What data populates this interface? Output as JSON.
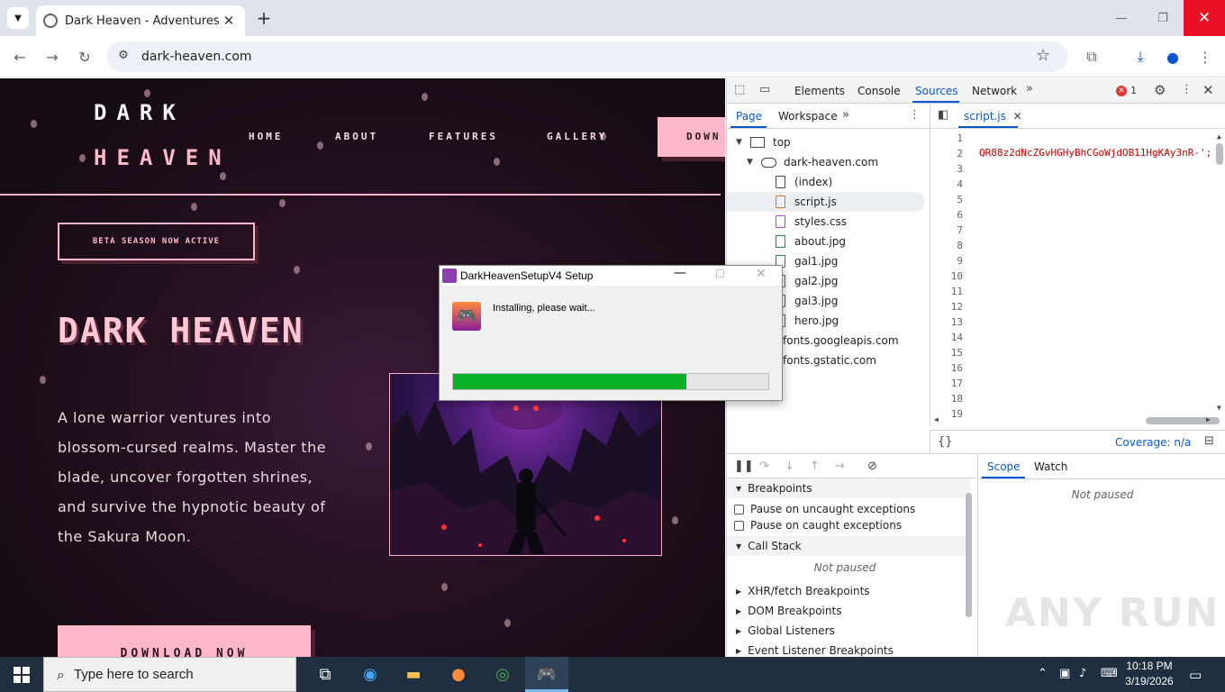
{
  "browser": {
    "tab_title": "Dark Heaven - Adventures of a",
    "url": "dark-heaven.com",
    "new_tab_glyph": "+"
  },
  "page": {
    "logo_line1": "DARK",
    "logo_line2": "HEAVEN",
    "nav": [
      "HOME",
      "ABOUT",
      "FEATURES",
      "GALLERY"
    ],
    "nav_download": "DOWN",
    "badge": "BETA SEASON NOW ACTIVE",
    "hero_title": "DARK HEAVEN",
    "hero_desc": "A lone warrior ventures into blossom-cursed realms. Master the blade, uncover forgotten shrines, and survive the hypnotic beauty of the Sakura Moon.",
    "hero_button": "DOWNLOAD NOW"
  },
  "devtools": {
    "tabs": [
      "Elements",
      "Console",
      "Sources",
      "Network"
    ],
    "error_count": "1",
    "left_tabs": [
      "Page",
      "Workspace"
    ],
    "tree": {
      "top": "top",
      "domain": "dark-heaven.com",
      "files": [
        "(index)",
        "script.js",
        "styles.css",
        "about.jpg",
        "gal1.jpg",
        "gal2.jpg",
        "gal3.jpg",
        "hero.jpg"
      ],
      "other_domains": [
        "fonts.googleapis.com",
        "fonts.gstatic.com"
      ]
    },
    "open_file": "script.js",
    "line_numbers": [
      "1",
      "2",
      "3",
      "4",
      "5",
      "6",
      "7",
      "8",
      "9",
      "10",
      "11",
      "12",
      "13",
      "14",
      "15",
      "16",
      "17",
      "18",
      "19"
    ],
    "code_line_2": "QR88z2dNcZGvHGHyBhCGoWjdOB11HgKAy3nR-';",
    "coverage": "Coverage: n/a",
    "breakpoints_header": "Breakpoints",
    "pause_uncaught": "Pause on uncaught exceptions",
    "pause_caught": "Pause on caught exceptions",
    "call_stack_header": "Call Stack",
    "not_paused": "Not paused",
    "collapsed_sections": [
      "XHR/fetch Breakpoints",
      "DOM Breakpoints",
      "Global Listeners",
      "Event Listener Breakpoints"
    ],
    "scope_tab": "Scope",
    "watch_tab": "Watch"
  },
  "installer": {
    "title": "DarkHeavenSetupV4 Setup",
    "status": "Installing, please wait...",
    "progress_fraction": 0.74
  },
  "taskbar": {
    "search_placeholder": "Type here to search",
    "time": "10:18 PM",
    "date": "3/19/2026"
  },
  "watermark": "ANY RUN",
  "colors": {
    "accent_pink": "#ffb7ca",
    "progress_green": "#06b025",
    "devtools_blue": "#0b57d0"
  }
}
